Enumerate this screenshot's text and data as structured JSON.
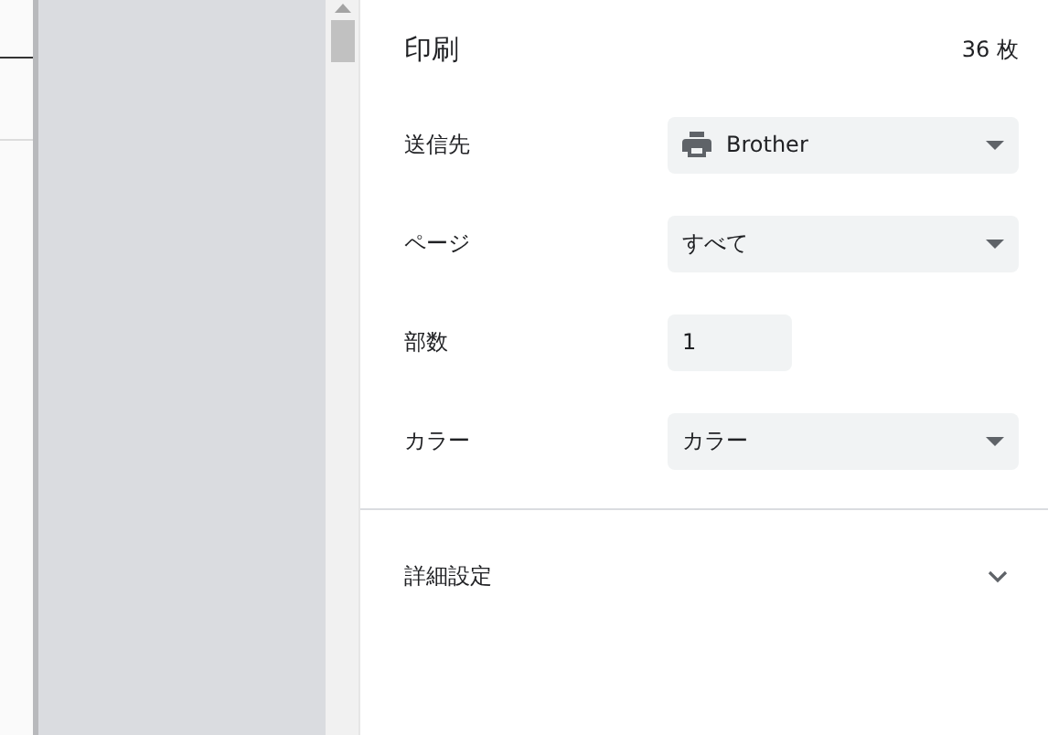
{
  "header": {
    "title": "印刷",
    "sheet_count": "36 枚"
  },
  "settings": [
    {
      "label": "送信先",
      "kind": "printer_select",
      "value": "Brother"
    },
    {
      "label": "ページ",
      "kind": "select",
      "value": "すべて"
    },
    {
      "label": "部数",
      "kind": "input",
      "value": "1"
    },
    {
      "label": "カラー",
      "kind": "select",
      "value": "カラー"
    }
  ],
  "advanced": {
    "label": "詳細設定",
    "expanded": false
  }
}
